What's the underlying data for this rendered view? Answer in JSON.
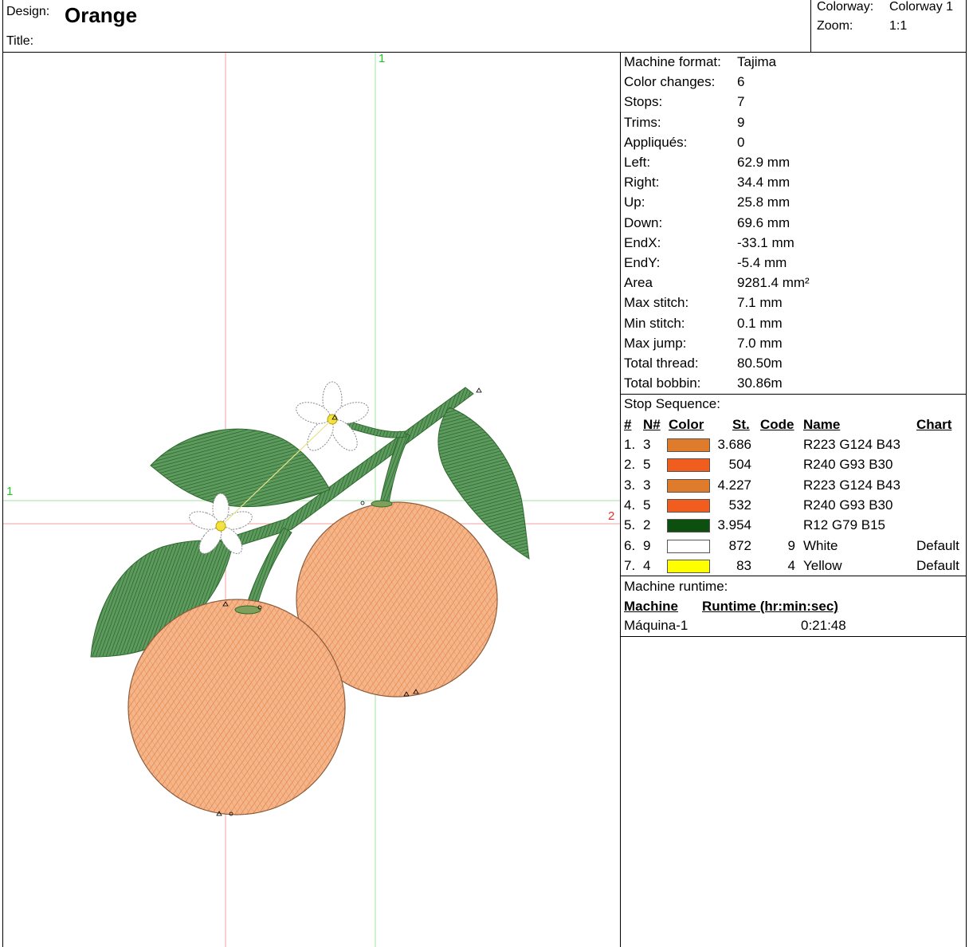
{
  "header": {
    "design_label": "Design:",
    "design_name": "Orange",
    "title_label": "Title:",
    "title_value": "",
    "colorway_label": "Colorway:",
    "colorway_value": "Colorway 1",
    "zoom_label": "Zoom:",
    "zoom_value": "1:1"
  },
  "axis_markers": {
    "top_green": "1",
    "left_green": "1",
    "right_red": "2"
  },
  "machine_info": [
    {
      "label": "Machine format:",
      "value": "Tajima"
    },
    {
      "label": "Color changes:",
      "value": "6"
    },
    {
      "label": "Stops:",
      "value": "7"
    },
    {
      "label": "Trims:",
      "value": "9"
    },
    {
      "label": "Appliqués:",
      "value": "0"
    },
    {
      "label": "Left:",
      "value": "62.9 mm"
    },
    {
      "label": "Right:",
      "value": "34.4 mm"
    },
    {
      "label": "Up:",
      "value": "25.8 mm"
    },
    {
      "label": "Down:",
      "value": "69.6 mm"
    },
    {
      "label": "EndX:",
      "value": "-33.1 mm"
    },
    {
      "label": "EndY:",
      "value": "-5.4 mm"
    },
    {
      "label": "Area",
      "value": "9281.4 mm²"
    },
    {
      "label": "Max stitch:",
      "value": "7.1 mm"
    },
    {
      "label": "Min stitch:",
      "value": "0.1 mm"
    },
    {
      "label": "Max jump:",
      "value": "7.0 mm"
    },
    {
      "label": "Total thread:",
      "value": "80.50m"
    },
    {
      "label": "Total bobbin:",
      "value": "30.86m"
    }
  ],
  "stop_sequence": {
    "title": "Stop Sequence:",
    "headers": {
      "idx": "#",
      "needle": "N#",
      "color": "Color",
      "stitches": "St.",
      "code": "Code",
      "name": "Name",
      "chart": "Chart"
    },
    "rows": [
      {
        "idx": "1.",
        "needle": "3",
        "color": "#DF7C2B",
        "stitches": "3.686",
        "code": "",
        "name": "R223 G124 B43",
        "chart": ""
      },
      {
        "idx": "2.",
        "needle": "5",
        "color": "#F05D1E",
        "stitches": "504",
        "code": "",
        "name": "R240 G93 B30",
        "chart": ""
      },
      {
        "idx": "3.",
        "needle": "3",
        "color": "#DF7C2B",
        "stitches": "4.227",
        "code": "",
        "name": "R223 G124 B43",
        "chart": ""
      },
      {
        "idx": "4.",
        "needle": "5",
        "color": "#F05D1E",
        "stitches": "532",
        "code": "",
        "name": "R240 G93 B30",
        "chart": ""
      },
      {
        "idx": "5.",
        "needle": "2",
        "color": "#0C4F0F",
        "stitches": "3.954",
        "code": "",
        "name": "R12 G79 B15",
        "chart": ""
      },
      {
        "idx": "6.",
        "needle": "9",
        "color": "#FFFFFF",
        "stitches": "872",
        "code": "9",
        "name": "White",
        "chart": "Default"
      },
      {
        "idx": "7.",
        "needle": "4",
        "color": "#FFFF00",
        "stitches": "83",
        "code": "4",
        "name": "Yellow",
        "chart": "Default"
      }
    ]
  },
  "runtime": {
    "title": "Machine runtime:",
    "headers": {
      "machine": "Machine",
      "runtime": "Runtime (hr:min:sec)"
    },
    "rows": [
      {
        "machine": "Máquina-1",
        "runtime": "0:21:48"
      }
    ]
  }
}
